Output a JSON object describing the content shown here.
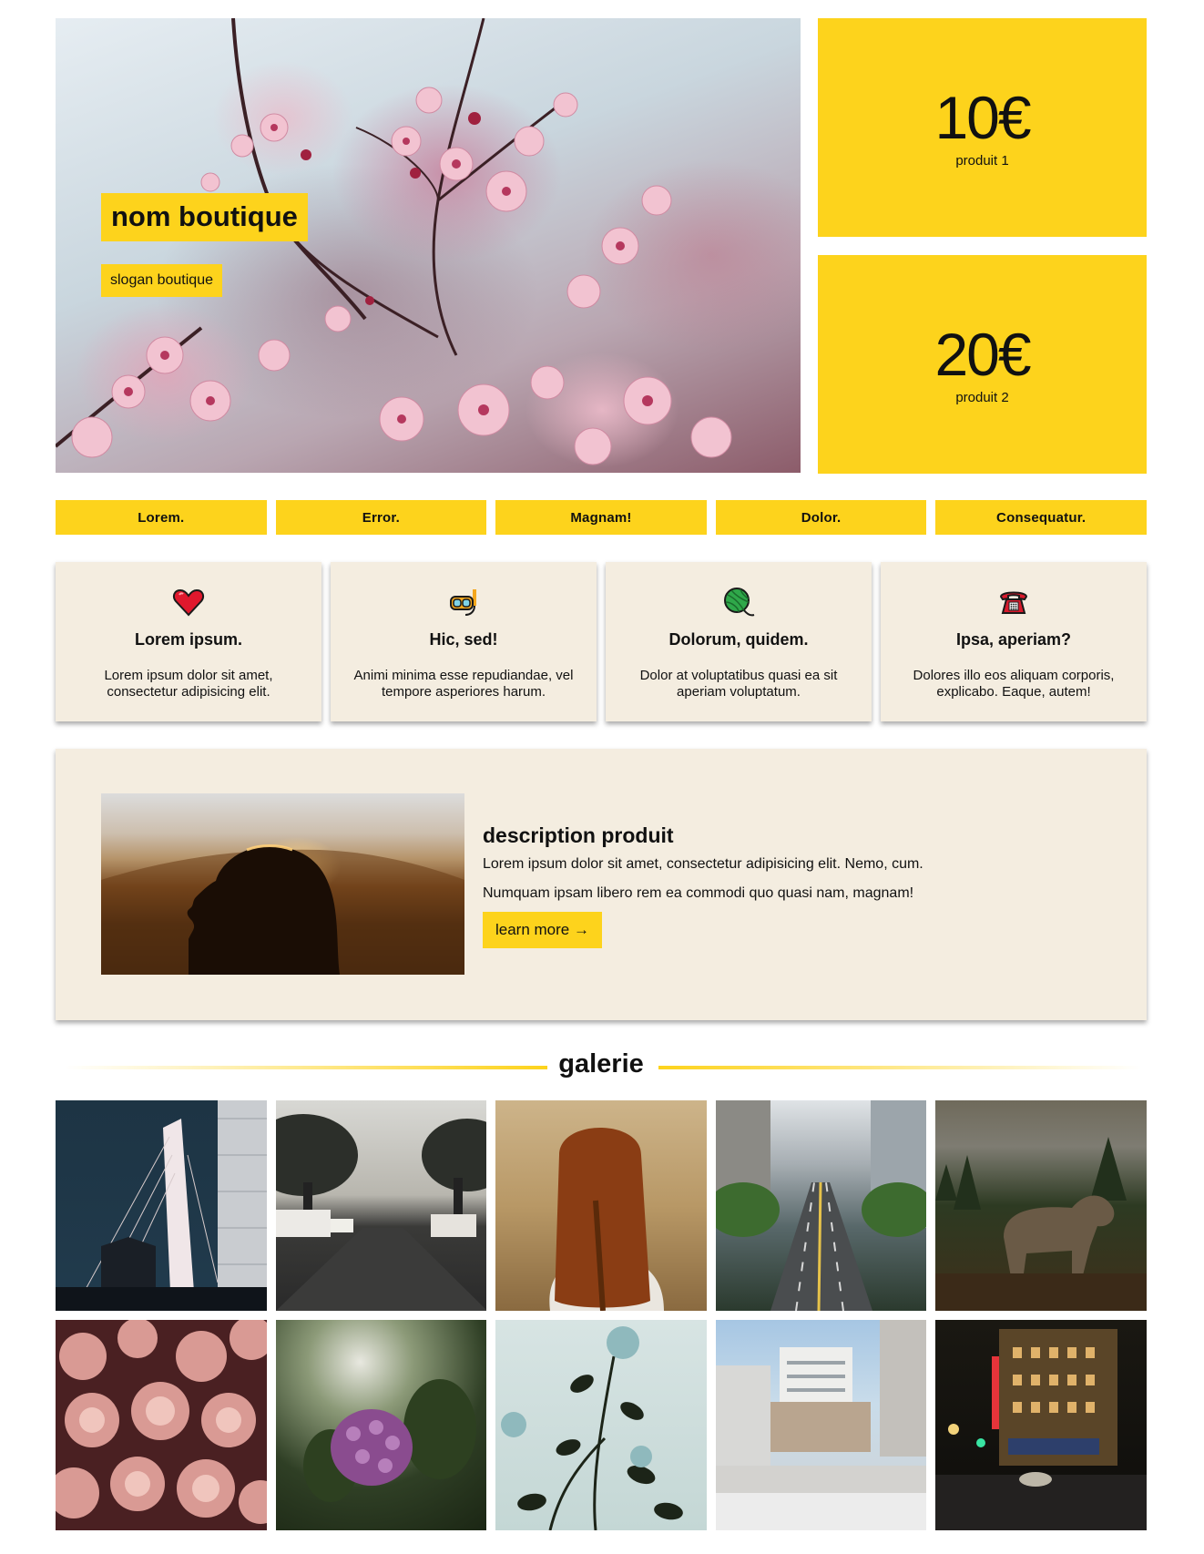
{
  "hero": {
    "shop_name": "nom boutique",
    "slogan": "slogan boutique"
  },
  "products": [
    {
      "price": "10€",
      "label": "produit 1"
    },
    {
      "price": "20€",
      "label": "produit 2"
    }
  ],
  "nav": {
    "items": [
      "Lorem.",
      "Error.",
      "Magnam!",
      "Dolor.",
      "Consequatur."
    ]
  },
  "features": [
    {
      "icon": "heart-icon",
      "title": "Lorem ipsum.",
      "text": "Lorem ipsum dolor sit amet, consectetur adipisicing elit."
    },
    {
      "icon": "diving-mask-icon",
      "title": "Hic, sed!",
      "text": "Animi minima esse repudiandae, vel tempore asperiores harum."
    },
    {
      "icon": "yarn-ball-icon",
      "title": "Dolorum, quidem.",
      "text": "Dolor at voluptatibus quasi ea sit aperiam voluptatum."
    },
    {
      "icon": "telephone-icon",
      "title": "Ipsa, aperiam?",
      "text": "Dolores illo eos aliquam corporis, explicabo. Eaque, autem!"
    }
  ],
  "product_description": {
    "title": "description produit",
    "line1": "Lorem ipsum dolor sit amet, consectetur adipisicing elit. Nemo, cum.",
    "line2": "Numquam ipsam libero rem ea commodi quo quasi nam, magnam!",
    "button": "learn more →"
  },
  "gallery": {
    "title": "galerie"
  },
  "colors": {
    "accent": "#fdd31c",
    "card_bg": "#f4ede0"
  }
}
